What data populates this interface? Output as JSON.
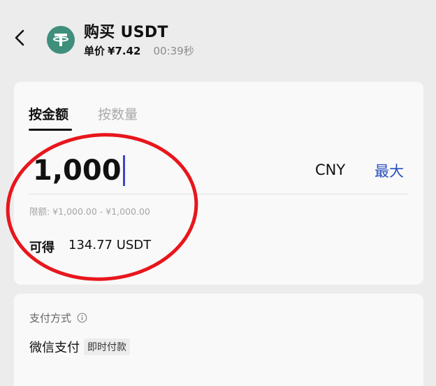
{
  "header": {
    "title": "购买 USDT",
    "price_label": "单价",
    "price_value": "¥7.42",
    "timer": "00:39秒"
  },
  "icons": {
    "back": "chevron-left-icon",
    "token": "tether-logo-icon",
    "info": "info-icon"
  },
  "tabs": [
    {
      "label": "按金额",
      "active": true
    },
    {
      "label": "按数量",
      "active": false
    }
  ],
  "amount": {
    "value": "1,000",
    "currency": "CNY",
    "max_label": "最大",
    "limit_text": "限额: ¥1,000.00 - ¥1,000.00"
  },
  "receive": {
    "label": "可得",
    "value": "134.77 USDT"
  },
  "payment": {
    "title": "支付方式",
    "method": "微信支付",
    "tag": "即时付款"
  },
  "colors": {
    "accent": "#2a4fbf",
    "token": "#3f8f7c",
    "annotation": "#e8161c"
  }
}
